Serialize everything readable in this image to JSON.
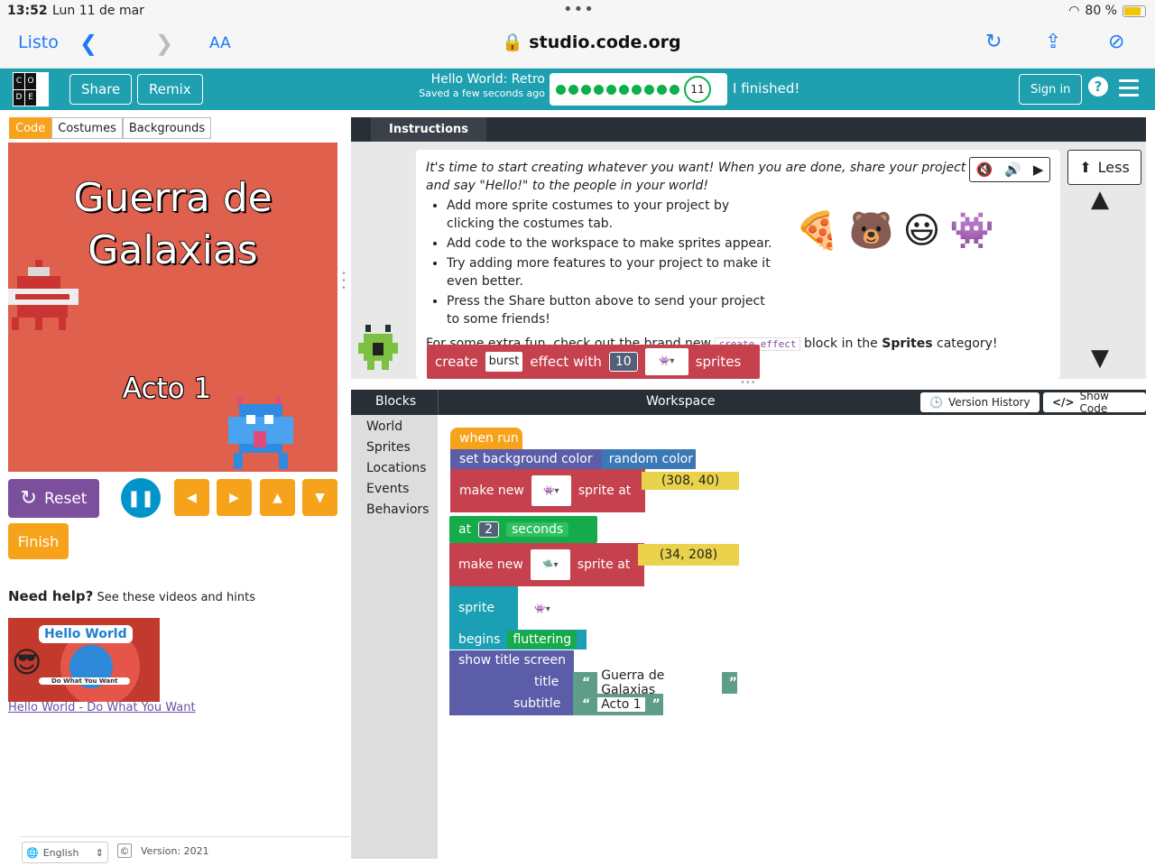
{
  "status": {
    "time": "13:52",
    "date": "Lun 11 de mar",
    "battery": "80 %"
  },
  "safari": {
    "done": "Listo",
    "aa": "AA",
    "url": "studio.code.org"
  },
  "header": {
    "logo_letters": [
      "C",
      "O",
      "",
      "D",
      "E",
      ""
    ],
    "share": "Share",
    "remix": "Remix",
    "project_title": "Hello World: Retro",
    "saved": "Saved a few seconds ago",
    "level": "11",
    "finished": "I finished!",
    "sign_in": "Sign in",
    "help": "?"
  },
  "left": {
    "tabs": [
      "Code",
      "Costumes",
      "Backgrounds"
    ],
    "stage_title_1": "Guerra de",
    "stage_title_2": "Galaxias",
    "stage_subtitle": "Acto 1",
    "reset": "Reset",
    "finish": "Finish",
    "need_help": "Need help?",
    "need_help_sub": "See these videos and hints",
    "video_title": "Hello World",
    "video_sub": "Do What You Want",
    "video_link": "Hello World - Do What You Want",
    "language": "English",
    "version": "Version: 2021"
  },
  "instructions": {
    "tab": "Instructions",
    "less": "Less",
    "lead": "It's time to start creating whatever you want! When you are done, share your project and say \"Hello!\" to the people in your world!",
    "bullets": [
      "Add more sprite costumes to your project by clicking the costumes tab.",
      "Add code to the workspace to make sprites appear.",
      "Try adding more features to your project to make it even better.",
      "Press the Share button above to send your project to some friends!"
    ],
    "extra_pre": "For some extra fun, check out the brand new",
    "extra_code": "create effect",
    "extra_mid": "block in the",
    "extra_bold": "Sprites",
    "extra_post": "category!",
    "demo": {
      "create": "create",
      "effect": "burst",
      "with": "effect with",
      "num": "10",
      "sprites": "sprites"
    }
  },
  "workspace": {
    "blocks_tab": "Blocks",
    "workspace_tab": "Workspace",
    "version_history": "Version History",
    "show_code": "Show Code",
    "categories": [
      "World",
      "Sprites",
      "Locations",
      "Events",
      "Behaviors"
    ],
    "when_run": "when run",
    "set_bg": "set background color",
    "random_color": "random color",
    "make_new": "make new",
    "sprite_at": "sprite at",
    "pos1": "(308, 40)",
    "at": "at",
    "seconds_num": "2",
    "seconds": "seconds",
    "pos2": "(34, 208)",
    "sprite": "sprite",
    "begins": "begins",
    "fluttering": "fluttering",
    "show_title": "show title screen",
    "title_label": "title",
    "title_value": "Guerra de Galaxias",
    "subtitle_label": "subtitle",
    "subtitle_value": "Acto 1"
  },
  "colors": {
    "teal": "#1ea0b0",
    "orange": "#f7a21b",
    "purple": "#5b5da8",
    "red": "#c5414d",
    "green": "#16ab4a",
    "stage": "#e0604e"
  }
}
